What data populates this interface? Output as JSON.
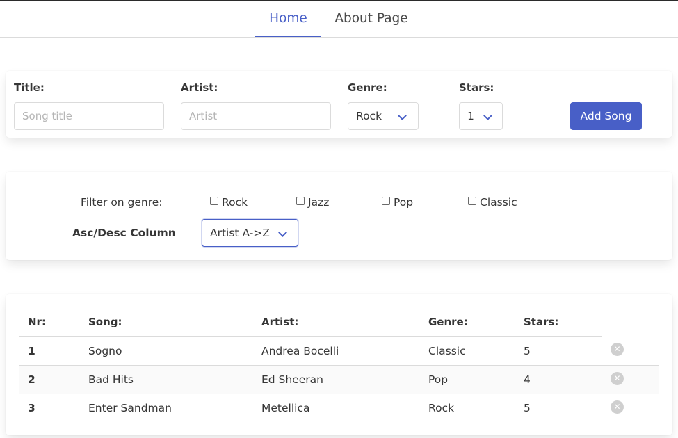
{
  "nav": {
    "tabs": [
      {
        "label": "Home"
      },
      {
        "label": "About Page"
      }
    ]
  },
  "form": {
    "title_label": "Title:",
    "title_placeholder": "Song title",
    "artist_label": "Artist:",
    "artist_placeholder": "Artist",
    "genre_label": "Genre:",
    "genre_value": "Rock",
    "stars_label": "Stars:",
    "stars_value": "1",
    "add_button": "Add Song"
  },
  "filter": {
    "label": "Filter on genre:",
    "genres": [
      "Rock",
      "Jazz",
      "Pop",
      "Classic"
    ],
    "sort_label": "Asc/Desc Column",
    "sort_value": "Artist A->Z"
  },
  "table": {
    "headers": [
      "Nr:",
      "Song:",
      "Artist:",
      "Genre:",
      "Stars:"
    ],
    "rows": [
      {
        "nr": "1",
        "song": "Sogno",
        "artist": "Andrea Bocelli",
        "genre": "Classic",
        "stars": "5"
      },
      {
        "nr": "2",
        "song": "Bad Hits",
        "artist": "Ed Sheeran",
        "genre": "Pop",
        "stars": "4"
      },
      {
        "nr": "3",
        "song": "Enter Sandman",
        "artist": "Metellica",
        "genre": "Rock",
        "stars": "5"
      }
    ]
  },
  "colors": {
    "accent": "#485fc7",
    "text": "#363636",
    "border": "#dbdbdb"
  }
}
